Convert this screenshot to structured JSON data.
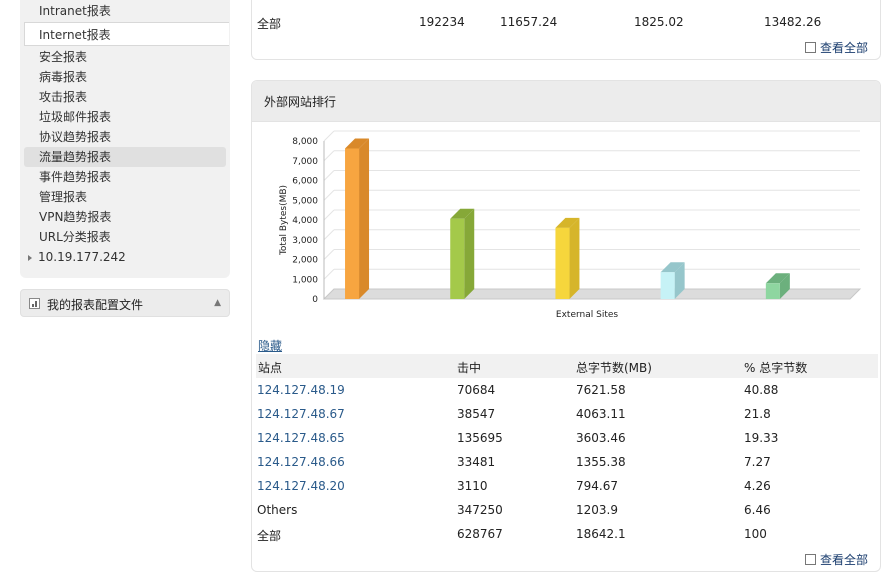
{
  "sidebar": {
    "items": [
      {
        "label": "Intranet报表"
      },
      {
        "label": "Internet报表"
      },
      {
        "label": "安全报表"
      },
      {
        "label": "病毒报表"
      },
      {
        "label": "攻击报表"
      },
      {
        "label": "垃圾邮件报表"
      },
      {
        "label": "协议趋势报表"
      },
      {
        "label": "流量趋势报表"
      },
      {
        "label": "事件趋势报表"
      },
      {
        "label": "管理报表"
      },
      {
        "label": "VPN趋势报表"
      },
      {
        "label": "URL分类报表"
      },
      {
        "label": "10.19.177.242"
      }
    ],
    "config": {
      "label": "我的报表配置文件"
    }
  },
  "top_summary": {
    "row_total": [
      "全部",
      "192234",
      "11657.24",
      "1825.02",
      "13482.26"
    ],
    "view_all": "查看全部"
  },
  "panel": {
    "title": "外部网站排行",
    "hide": "隐藏",
    "view_all": "查看全部",
    "headers": [
      "站点",
      "击中",
      "总字节数(MB)",
      "% 总字节数"
    ],
    "rows": [
      [
        "124.127.48.19",
        "70684",
        "7621.58",
        "40.88"
      ],
      [
        "124.127.48.67",
        "38547",
        "4063.11",
        "21.8"
      ],
      [
        "124.127.48.65",
        "135695",
        "3603.46",
        "19.33"
      ],
      [
        "124.127.48.66",
        "33481",
        "1355.38",
        "7.27"
      ],
      [
        "124.127.48.20",
        "3110",
        "794.67",
        "4.26"
      ],
      [
        "Others",
        "347250",
        "1203.9",
        "6.46"
      ],
      [
        "全部",
        "628767",
        "18642.1",
        "100"
      ]
    ]
  },
  "chart_data": {
    "type": "bar",
    "xlabel": "External Sites",
    "ylabel": "Total Bytes(MB)",
    "ylim": [
      0,
      8000
    ],
    "yticks": [
      "0",
      "1,000",
      "2,000",
      "3,000",
      "4,000",
      "5,000",
      "6,000",
      "7,000",
      "8,000"
    ],
    "values": [
      7621.58,
      4063.11,
      3603.46,
      1355.38,
      794.67
    ],
    "colors": [
      "#f7a540",
      "#a4c94a",
      "#f6d63c",
      "#c6f2f6",
      "#8ed6a0"
    ],
    "side_colors": [
      "#d9892a",
      "#86a838",
      "#d6b52a",
      "#96c6cb",
      "#6cb07d"
    ],
    "grid": true
  }
}
